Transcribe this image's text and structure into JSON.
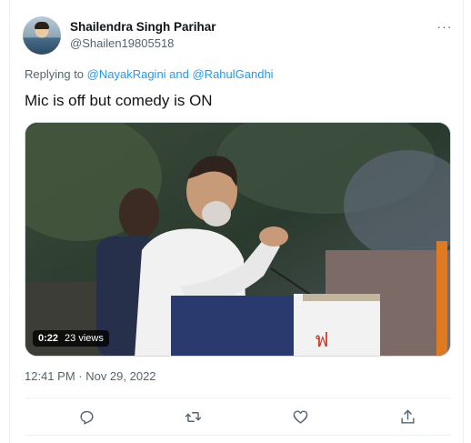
{
  "author": {
    "name": "Shailendra Singh Parihar",
    "handle": "@Shailen19805518"
  },
  "more_label": "···",
  "reply_context": {
    "prefix": "Replying to ",
    "mention1": "@NayakRagini",
    "joiner": " and ",
    "mention2": "@RahulGandhi"
  },
  "tweet_text": "Mic is off but comedy is ON",
  "media": {
    "duration": "0:22",
    "views": "23 views"
  },
  "timestamp": "12:41 PM · Nov 29, 2022",
  "actions": [
    {
      "name": "reply-icon"
    },
    {
      "name": "retweet-icon"
    },
    {
      "name": "like-icon"
    },
    {
      "name": "share-icon"
    }
  ],
  "colors": {
    "link": "#1d9bf0",
    "secondary_text": "#536471",
    "primary_text": "#0f1419"
  }
}
